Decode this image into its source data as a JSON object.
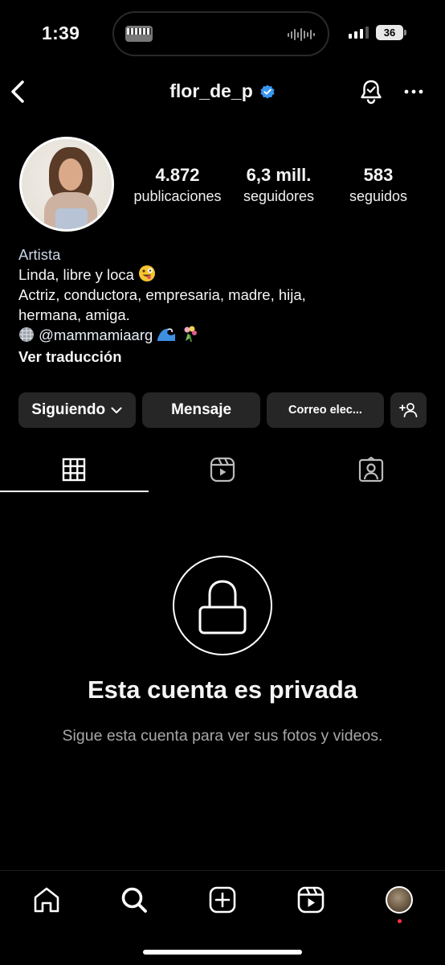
{
  "status_bar": {
    "time": "1:39",
    "battery": "36"
  },
  "header": {
    "username": "flor_de_p"
  },
  "profile": {
    "stats": [
      {
        "value": "4.872",
        "label": "publicaciones"
      },
      {
        "value": "6,3 mill.",
        "label": "seguidores"
      },
      {
        "value": "583",
        "label": "seguidos"
      }
    ],
    "bio": {
      "category": "Artista",
      "line1": "Linda, libre y loca",
      "line2": "Actriz, conductora, empresaria, madre, hija,",
      "line3": "hermana, amiga.",
      "mention": "@mammamiaarg",
      "translate": "Ver traducción"
    }
  },
  "actions": {
    "following": "Siguiendo",
    "message": "Mensaje",
    "email": "Correo elec..."
  },
  "private": {
    "title": "Esta cuenta es privada",
    "subtitle": "Sigue esta cuenta para ver sus fotos y videos."
  },
  "colors": {
    "background": "#000000",
    "button_bg": "#262626",
    "verified_blue": "#3897f0",
    "secondary_text": "#a8a8a8",
    "notification_dot": "#ff3040"
  }
}
